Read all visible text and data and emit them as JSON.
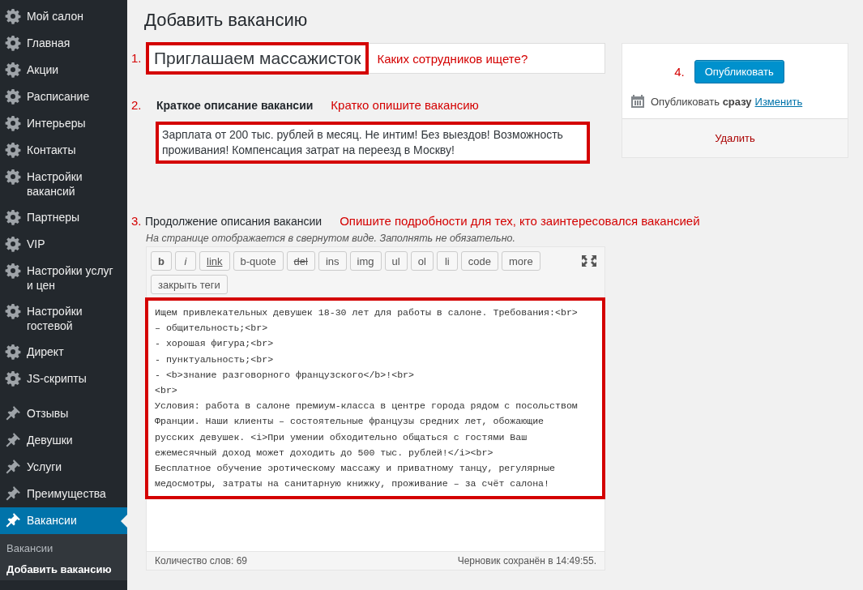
{
  "sidebar": {
    "items": [
      {
        "label": "Мой салон",
        "kind": "settings",
        "selected": false
      },
      {
        "label": "Главная",
        "kind": "settings",
        "selected": false
      },
      {
        "label": "Акции",
        "kind": "settings",
        "selected": false
      },
      {
        "label": "Расписание",
        "kind": "settings",
        "selected": false
      },
      {
        "label": "Интерьеры",
        "kind": "settings",
        "selected": false
      },
      {
        "label": "Контакты",
        "kind": "settings",
        "selected": false
      },
      {
        "label": "Настройки вакансий",
        "kind": "settings",
        "selected": false
      },
      {
        "label": "Партнеры",
        "kind": "settings",
        "selected": false
      },
      {
        "label": "VIP",
        "kind": "settings",
        "selected": false
      },
      {
        "label": "Настройки услуг и цен",
        "kind": "settings",
        "selected": false
      },
      {
        "label": "Настройки гостевой",
        "kind": "settings",
        "selected": false
      },
      {
        "label": "Директ",
        "kind": "settings",
        "selected": false
      },
      {
        "label": "JS-скрипты",
        "kind": "settings",
        "selected": false
      },
      {
        "label": "Отзывы",
        "kind": "posts",
        "selected": false
      },
      {
        "label": "Девушки",
        "kind": "posts",
        "selected": false
      },
      {
        "label": "Услуги",
        "kind": "posts",
        "selected": false
      },
      {
        "label": "Преимущества",
        "kind": "posts",
        "selected": false
      },
      {
        "label": "Вакансии",
        "kind": "posts",
        "selected": true
      }
    ],
    "submenu": [
      {
        "label": "Вакансии",
        "selected": false
      },
      {
        "label": "Добавить вакансию",
        "selected": true
      }
    ]
  },
  "page_title": "Добавить вакансию",
  "title_field": {
    "marker": "1.",
    "value": "Приглашаем массажисток",
    "hint": "Каких сотрудников ищете?",
    "highlighted": true
  },
  "excerpt": {
    "marker": "2.",
    "label": "Краткое описание вакансии",
    "hint": "Кратко опишите вакансию",
    "value": "Зарплата от 200 тыс. рублей в месяц. Не интим! Без выездов! Возможность проживания! Компенсация затрат на переезд в Москву!",
    "highlighted": true
  },
  "content": {
    "marker": "3.",
    "label": "Продолжение описания вакансии",
    "hint": "Опишите подробности для тех, кто заинтересовался вакансией",
    "description": "На странице отображается в свернутом виде. Заполнять не обязательно.",
    "toolbar": [
      {
        "label": "b",
        "kind": "bold"
      },
      {
        "label": "i",
        "kind": "italic"
      },
      {
        "label": "link",
        "kind": "link"
      },
      {
        "label": "b-quote",
        "kind": "plain"
      },
      {
        "label": "del",
        "kind": "strike"
      },
      {
        "label": "ins",
        "kind": "plain"
      },
      {
        "label": "img",
        "kind": "plain"
      },
      {
        "label": "ul",
        "kind": "plain"
      },
      {
        "label": "ol",
        "kind": "plain"
      },
      {
        "label": "li",
        "kind": "plain"
      },
      {
        "label": "code",
        "kind": "plain"
      },
      {
        "label": "more",
        "kind": "plain"
      },
      {
        "label": "закрыть теги",
        "kind": "plain"
      }
    ],
    "lines": [
      "Ищем привлекательных девушек 18-30 лет для работы в салоне. Требования:<br>",
      "– общительность;<br>",
      "- хорошая фигура;<br>",
      "- пунктуальность;<br>",
      "- <b>знание разговорного французского</b>!<br>",
      "<br>",
      "Условия: работа в салоне премиум-класса в центре города рядом с посольством",
      "Франции. Наши клиенты – состоятельные французы средних лет, обожающие",
      "русских девушек. <i>При умении обходительно общаться с гостями Ваш",
      "ежемесячный доход может доходить до 500 тыс. рублей!</i><br>",
      "Бесплатное обучение эротическому массажу и приватному танцу, регулярные",
      "медосмотры, затраты на санитарную книжку, проживание – за счёт салона!"
    ],
    "highlighted": true,
    "word_count": "Количество слов: 69",
    "draft_status": "Черновик сохранён в 14:49:55."
  },
  "publish": {
    "marker": "4.",
    "button": "Опубликовать",
    "schedule": "Опубликовать **сразу**",
    "edit_link": "Изменить",
    "delete_link": "Удалить"
  }
}
